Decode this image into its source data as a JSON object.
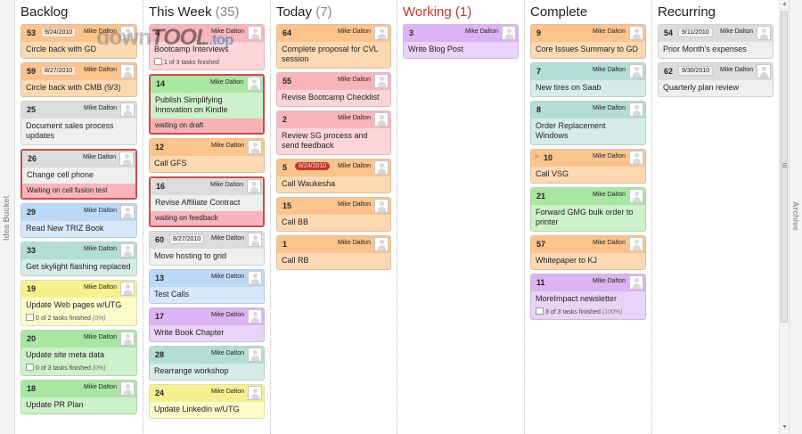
{
  "rails": {
    "left_label": "Idea Bucket",
    "right_label": "Archive"
  },
  "watermark": {
    "part1": "down",
    "part2": "TOOL",
    "part3": ".top"
  },
  "columns": {
    "backlog": {
      "title": "Backlog",
      "count": "",
      "cards": [
        {
          "id": "53",
          "date": "9/24/2010",
          "owner": "Mike Dalton",
          "title": "Circle back with GD",
          "color": "orange"
        },
        {
          "id": "59",
          "date": "8/27/2010",
          "owner": "Mike Dalton",
          "title": "Circle back with CMB (9/3)",
          "color": "orange"
        },
        {
          "id": "25",
          "owner": "Mike Dalton",
          "title": "Document sales process updates",
          "color": "gray"
        },
        {
          "id": "26",
          "owner": "Mike Dalton",
          "title": "Change cell phone",
          "note": "Waiting on cell fusion test",
          "color": "gray",
          "blocked": true
        },
        {
          "id": "29",
          "owner": "Mike Dalton",
          "title": "Read New TRIZ Book",
          "color": "blue"
        },
        {
          "id": "33",
          "owner": "Mike Dalton",
          "title": "Get skylight flashing replaced",
          "color": "teal"
        },
        {
          "id": "19",
          "owner": "Mike Dalton",
          "title": "Update Web pages w/UTG",
          "tasks": "0 of 2 tasks finished",
          "pct": "(0%)",
          "color": "yellow"
        },
        {
          "id": "20",
          "owner": "Mike Dalton",
          "title": "Update site meta data",
          "tasks": "0 of 3 tasks finished",
          "pct": "(0%)",
          "color": "green"
        },
        {
          "id": "18",
          "owner": "Mike Dalton",
          "title": "Update PR Plan",
          "color": "green"
        }
      ]
    },
    "thisweek": {
      "title": "This Week",
      "count": "(35)",
      "cards": [
        {
          "id": "4",
          "owner": "Mike Dalton",
          "title": "Bootcamp Interviews",
          "tasks": "1 of 3 tasks finished",
          "color": "pink"
        },
        {
          "id": "14",
          "owner": "Mike Dalton",
          "title": "Publish Simplifying Innovation on Kindle",
          "note": "waiting on draft",
          "color": "green",
          "blocked": true
        },
        {
          "id": "12",
          "owner": "Mike Dalton",
          "title": "Call GFS",
          "color": "orange"
        },
        {
          "id": "16",
          "owner": "Mike Dalton",
          "title": "Revise Affiliate Contract",
          "note": "waiting on feedback",
          "color": "gray",
          "blocked": true
        },
        {
          "id": "60",
          "date": "8/27/2010",
          "owner": "Mike Dalton",
          "title": "Move hosting to grid",
          "color": "gray"
        },
        {
          "id": "13",
          "owner": "Mike Dalton",
          "title": "Test Calls",
          "color": "blue"
        },
        {
          "id": "17",
          "owner": "Mike Dalton",
          "title": "Write Book Chapter",
          "color": "purple"
        },
        {
          "id": "28",
          "owner": "Mike Dalton",
          "title": "Rearrange workshop",
          "color": "teal"
        },
        {
          "id": "24",
          "owner": "Mike Dalton",
          "title": "Update Linkedin w/UTG",
          "color": "yellow"
        }
      ]
    },
    "today": {
      "title": "Today",
      "count": "(7)",
      "cards": [
        {
          "id": "64",
          "owner": "Mike Dalton",
          "title": "Complete proposal for CVL session",
          "color": "orange"
        },
        {
          "id": "55",
          "owner": "Mike Dalton",
          "title": "Revise Bootcamp Checklist",
          "color": "pink"
        },
        {
          "id": "2",
          "owner": "Mike Dalton",
          "title": "Review SG process and send feedback",
          "color": "pink"
        },
        {
          "id": "5",
          "pill": "8/24/2010",
          "owner": "Mike Dalton",
          "title": "Call Waukesha",
          "color": "orange"
        },
        {
          "id": "15",
          "owner": "Mike Dalton",
          "title": "Call BB",
          "color": "orange"
        },
        {
          "id": "1",
          "owner": "Mike Dalton",
          "title": "Call RB",
          "color": "orange"
        }
      ]
    },
    "working": {
      "title": "Working",
      "count": "(1)",
      "cards": [
        {
          "id": "3",
          "owner": "Mike Dalton",
          "title": "Write Blog Post",
          "color": "purple"
        }
      ]
    },
    "complete": {
      "title": "Complete",
      "count": "",
      "cards": [
        {
          "id": "9",
          "owner": "Mike Dalton",
          "title": "Core Issues Summary to GD",
          "color": "orange"
        },
        {
          "id": "7",
          "owner": "Mike Dalton",
          "title": "New tires on Saab",
          "color": "teal"
        },
        {
          "id": "8",
          "owner": "Mike Dalton",
          "title": "Order Replacement Windows",
          "color": "teal"
        },
        {
          "id": "10",
          "owner": "Mike Dalton",
          "title": "Call VSG",
          "color": "orange",
          "glyph": true
        },
        {
          "id": "21",
          "owner": "Mike Dalton",
          "title": "Forward GMG bulk order to printer",
          "color": "green"
        },
        {
          "id": "57",
          "owner": "Mike Dalton",
          "title": "Whitepaper to KJ",
          "color": "orange"
        },
        {
          "id": "11",
          "owner": "Mike Dalton",
          "title": "MoreImpact newsletter",
          "tasks": "3 of 3 tasks finished",
          "pct": "(100%)",
          "color": "purple"
        }
      ]
    },
    "recurring": {
      "title": "Recurring",
      "count": "",
      "cards": [
        {
          "id": "54",
          "date": "9/11/2010",
          "owner": "Mike Dalton",
          "title": "Prior Month's expenses",
          "color": "gray"
        },
        {
          "id": "62",
          "date": "9/30/2010",
          "owner": "Mike Dalton",
          "title": "Quarterly plan review",
          "color": "gray"
        }
      ]
    }
  }
}
